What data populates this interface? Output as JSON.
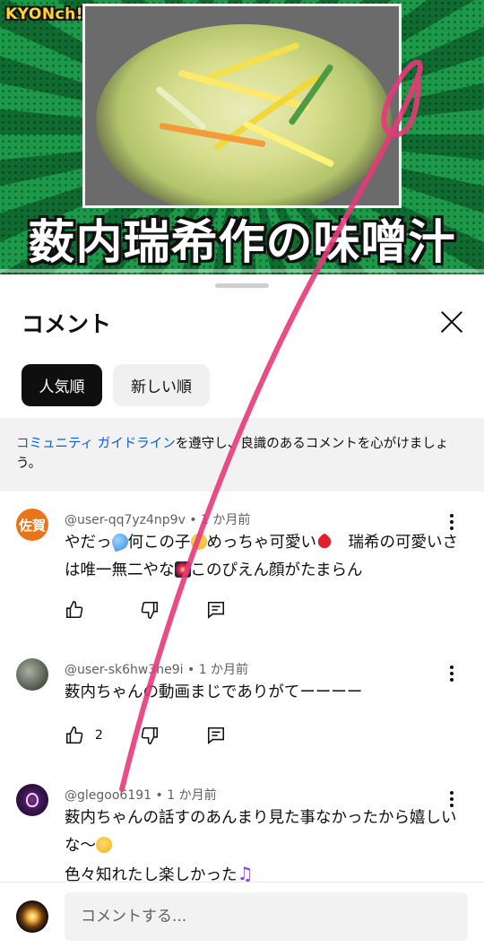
{
  "video": {
    "brand": "KYONch!",
    "overlay_title": "薮内瑞希作の味噌汁",
    "progress": 0.0
  },
  "sheet": {
    "title": "コメント",
    "sort_chips": [
      {
        "label": "人気順",
        "active": true
      },
      {
        "label": "新しい順",
        "active": false
      }
    ],
    "guideline_link": "コミュニティ ガイドライン",
    "guideline_text": "を遵守し、良識のあるコメントを心がけましょう。"
  },
  "comments": [
    {
      "author": "@user-qq7yz4np9v",
      "time": "1 か月前",
      "avatar_text": "佐賀",
      "text_parts": [
        "やだっ",
        "何この子",
        "めっちゃ可愛い",
        "　瑞希の可愛いさは唯一無二やな",
        "このぴえん顔がたまらん"
      ],
      "emoji": [
        "sweat-droplets-emoji",
        "smiling-face-emoji",
        "red-heart-emoji",
        "fireworks-emoji"
      ],
      "likes": ""
    },
    {
      "author": "@user-sk6hw3he9i",
      "time": "1 か月前",
      "text_parts": [
        "薮内ちゃんの動画まじでありがてーーーー"
      ],
      "likes": "2"
    },
    {
      "author": "@glegoo6191",
      "time": "1 か月前",
      "text_parts": [
        "薮内ちゃんの話すのあんまり見た事なかったから嬉しいな〜",
        "色々知れたし楽しかった"
      ],
      "emoji": [
        "smiling-face-emoji",
        "musical-notes-emoji"
      ],
      "likes": ""
    }
  ],
  "composer": {
    "placeholder": "コメントする..."
  },
  "colors": {
    "accent_link": "#065fd4",
    "chip_active": "#0f0f0f",
    "scribble": "#e8387a",
    "avatar_orange": "#ea7419"
  }
}
